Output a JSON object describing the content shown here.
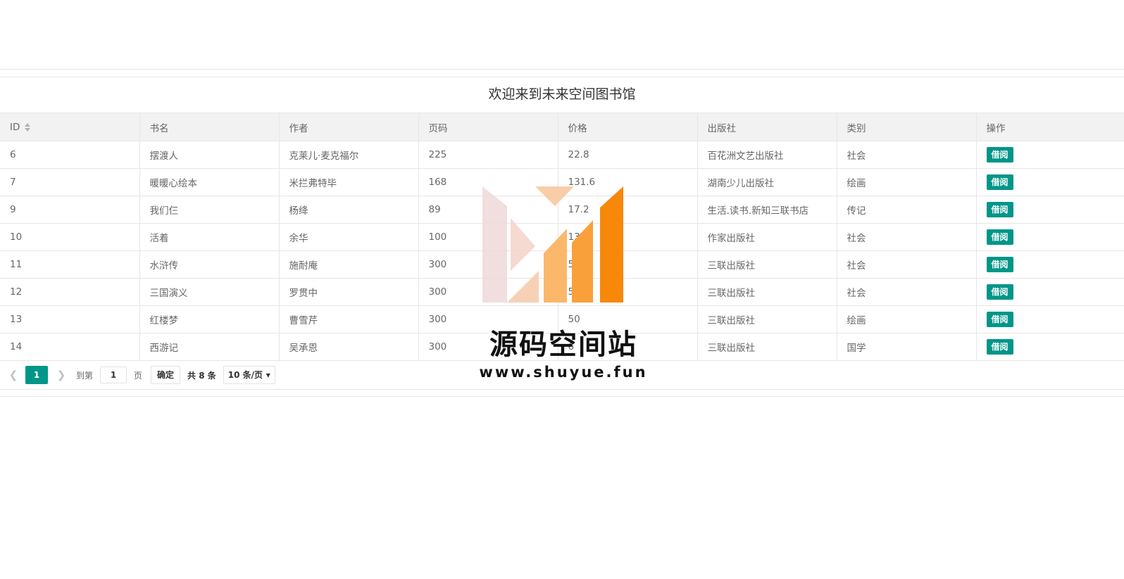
{
  "page": {
    "title": "欢迎来到未来空间图书馆"
  },
  "table": {
    "columns": [
      "ID",
      "书名",
      "作者",
      "页码",
      "价格",
      "出版社",
      "类别",
      "操作"
    ],
    "rows": [
      [
        "6",
        "摆渡人",
        "克莱儿·麦克福尔",
        "225",
        "22.8",
        "百花洲文艺出版社",
        "社会",
        "借阅"
      ],
      [
        "7",
        "暖暖心绘本",
        "米拦弗特毕",
        "168",
        "131.6",
        "湖南少儿出版社",
        "绘画",
        "借阅"
      ],
      [
        "9",
        "我们仨",
        "杨绛",
        "89",
        "17.2",
        "生活.读书.新知三联书店",
        "传记",
        "借阅"
      ],
      [
        "10",
        "活着",
        "余华",
        "100",
        "13",
        "作家出版社",
        "社会",
        "借阅"
      ],
      [
        "11",
        "水浒传",
        "施耐庵",
        "300",
        "5",
        "三联出版社",
        "社会",
        "借阅"
      ],
      [
        "12",
        "三国演义",
        "罗贯中",
        "300",
        "5",
        "三联出版社",
        "社会",
        "借阅"
      ],
      [
        "13",
        "红楼梦",
        "曹雪芹",
        "300",
        "50",
        "三联出版社",
        "绘画",
        "借阅"
      ],
      [
        "14",
        "西游记",
        "吴承恩",
        "300",
        "6",
        "三联出版社",
        "国学",
        "借阅"
      ]
    ]
  },
  "pager": {
    "prev_icon": "chevron-left-icon",
    "next_icon": "chevron-right-icon",
    "current": "1",
    "goto_label": "到第",
    "goto_value": "1",
    "page_label": "页",
    "confirm": "确定",
    "total": "共 8 条",
    "page_size": "10 条/页"
  },
  "watermark": {
    "title": "源码空间站",
    "url": "www.shuyue.fun"
  },
  "colors": {
    "accent": "#009688",
    "header_bg": "#f2f2f2",
    "border": "#e6e6e6"
  }
}
